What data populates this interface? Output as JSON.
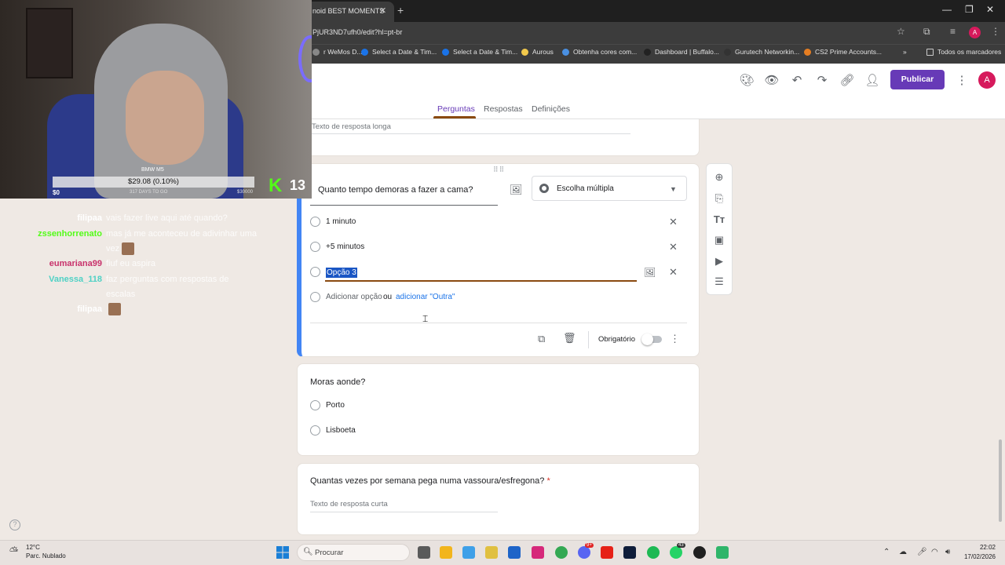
{
  "browser": {
    "tab_title": "noid BEST MOMENTS",
    "url": "PjUR3ND7ufh0/edit?hl=pt-br",
    "avatar_letter": "A",
    "bookmarks": [
      {
        "label": "r WeMos D...",
        "color": "#888888"
      },
      {
        "label": "Select a Date & Tim...",
        "color": "#1a73e8"
      },
      {
        "label": "Select a Date & Tim...",
        "color": "#1a73e8"
      },
      {
        "label": "Aurous",
        "color": "#f2c94c"
      },
      {
        "label": "Obtenha cores com...",
        "color": "#4a90e2"
      },
      {
        "label": "Dashboard | Buffalo...",
        "color": "#222222"
      },
      {
        "label": "Gurutech Networkin...",
        "color": "#333333"
      },
      {
        "label": "CS2 Prime Accounts...",
        "color": "#e67e22"
      }
    ],
    "bookmarks_more": "»",
    "all_bookmarks": "Todos os marcadores"
  },
  "header": {
    "publish": "Publicar",
    "user_letter": "A",
    "tabs": [
      "Perguntas",
      "Respostas",
      "Definições"
    ]
  },
  "form": {
    "prev_placeholder": "Texto de resposta longa",
    "active_question": {
      "title": "Quanto tempo demoras a fazer a cama?",
      "type": "Escolha múltipla",
      "options": [
        "1 minuto",
        "+5 minutos",
        "Opção 3"
      ],
      "add_option": "Adicionar opção",
      "or": "ou",
      "add_other": "adicionar \"Outra\"",
      "required_label": "Obrigatório"
    },
    "q2": {
      "title": "Moras aonde?",
      "options": [
        "Porto",
        "Lisboeta"
      ]
    },
    "q3": {
      "title": "Quantas vezes por semana pega numa vassoura/esfregona?",
      "required_mark": "*",
      "placeholder": "Texto de resposta curta"
    }
  },
  "stream": {
    "car_label": "BMW M5",
    "price": "$29.08 (0.10%)",
    "start": "$0",
    "days": "317 DAYS TO GO",
    "goal": "$30000",
    "kick_letter": "K",
    "kick_count": "13",
    "chat": [
      {
        "user": "filipaa",
        "color": "#ffffff",
        "msg": "vais fazer live aqui até quando?",
        "emote": false
      },
      {
        "user": "zssenhorrenato",
        "color": "#53fc18",
        "msg": "mas já me aconteceu de adivinhar uma vez",
        "emote": true
      },
      {
        "user": "eumariana99",
        "color": "#c8326b",
        "msg": "fiuf eu aspira",
        "emote": false
      },
      {
        "user": "Vanessa_118",
        "color": "#4fd1c5",
        "msg": "faz perguntas com respostas de escalas",
        "emote": false
      },
      {
        "user": "filipaa",
        "color": "#ffffff",
        "msg": "",
        "emote": true
      }
    ]
  },
  "taskbar": {
    "temp": "12°C",
    "weather": "Parc. Nublado",
    "search": "Procurar",
    "time": "22:02",
    "date": "17/02/2026",
    "badges": {
      "discord": "9+",
      "whatsapp": "43"
    }
  }
}
